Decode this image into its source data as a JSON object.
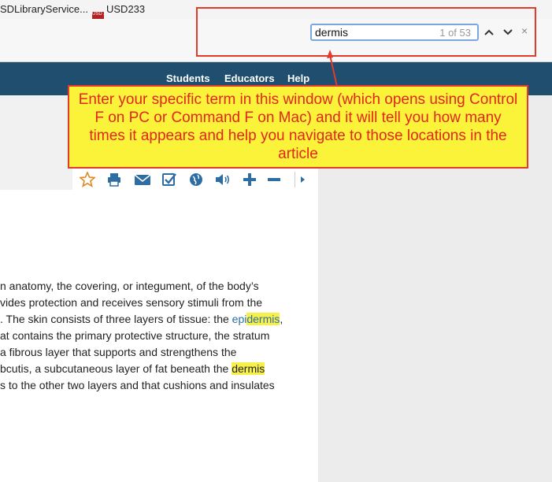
{
  "bookmarks": {
    "item1": "SDLibraryService...",
    "item2": "USD233",
    "item2_icon_text": "USD 233"
  },
  "find": {
    "query": "dermis",
    "count": "1 of 53",
    "up": "^",
    "down": "v",
    "close": "×"
  },
  "nav": {
    "students": "Students",
    "educators": "Educators",
    "help": "Help"
  },
  "callout": {
    "text": "Enter your specific term in this window (which opens using Control F on PC or Command F on Mac) and it will tell you how many times it appears and help you navigate to those locations in the article"
  },
  "toolbar": {
    "icons": [
      "star-icon",
      "print-icon",
      "email-icon",
      "checklist-icon",
      "globe-icon",
      "audio-icon",
      "plus-icon",
      "minus-icon",
      "arrow-right-icon"
    ]
  },
  "article": {
    "line1": "n anatomy, the covering, or integument, of the body’s",
    "line2": "vides protection and receives sensory stimuli from the",
    "line3_a": ". The skin consists of three layers of tissue: the ",
    "line3_link": "epi",
    "line3_hl": "dermis",
    "line3_b": ",",
    "line4": "at contains the primary protective structure, the stratum",
    "line5": " a fibrous layer that supports and strengthens the",
    "line6_a": "bcutis, a subcutaneous layer of fat beneath the ",
    "line6_hl": "dermis",
    "line7": "s to the other two layers and that cushions and insulates"
  },
  "colors": {
    "nav": "#1f4e6e",
    "highlight": "#f8f04a",
    "callout_bg": "#fbf33a",
    "callout_border": "#e23b2e",
    "link": "#2e6da4"
  }
}
